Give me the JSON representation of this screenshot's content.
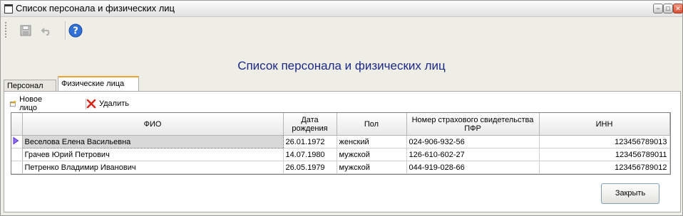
{
  "window": {
    "title": "Список персонала и физических лиц"
  },
  "page": {
    "heading": "Список персонала и физических лиц"
  },
  "tabs": [
    {
      "label": "Персонал",
      "active": false
    },
    {
      "label": "Физические лица",
      "active": true
    }
  ],
  "subtoolbar": {
    "new_label": "Новое лицо",
    "delete_label": "Удалить"
  },
  "table": {
    "columns": [
      "ФИО",
      "Дата рождения",
      "Пол",
      "Номер страхового свидетельства ПФР",
      "ИНН"
    ],
    "rows": [
      {
        "fio": "Веселова Елена Васильевна",
        "dob": "26.01.1972",
        "sex": "женский",
        "pfr": "024-906-932-56",
        "inn": "123456789013",
        "selected": true
      },
      {
        "fio": "Грачев Юрий Петрович",
        "dob": "14.07.1980",
        "sex": "мужской",
        "pfr": "126-610-602-27",
        "inn": "123456789011",
        "selected": false
      },
      {
        "fio": "Петренко Владимир Иванович",
        "dob": "26.05.1979",
        "sex": "мужской",
        "pfr": "044-919-028-66",
        "inn": "123456789012",
        "selected": false
      }
    ]
  },
  "footer": {
    "close_label": "Закрыть"
  },
  "colors": {
    "heading": "#1c2a86",
    "tab_accent": "#f0a22a",
    "delete_icon": "#d12a1a",
    "row_pointer": "#5b2bd6"
  },
  "icons": {
    "title": "window-icon",
    "save": "save-icon",
    "undo": "undo-icon",
    "help": "help-icon",
    "new": "new-document-icon",
    "delete": "delete-x-icon"
  }
}
